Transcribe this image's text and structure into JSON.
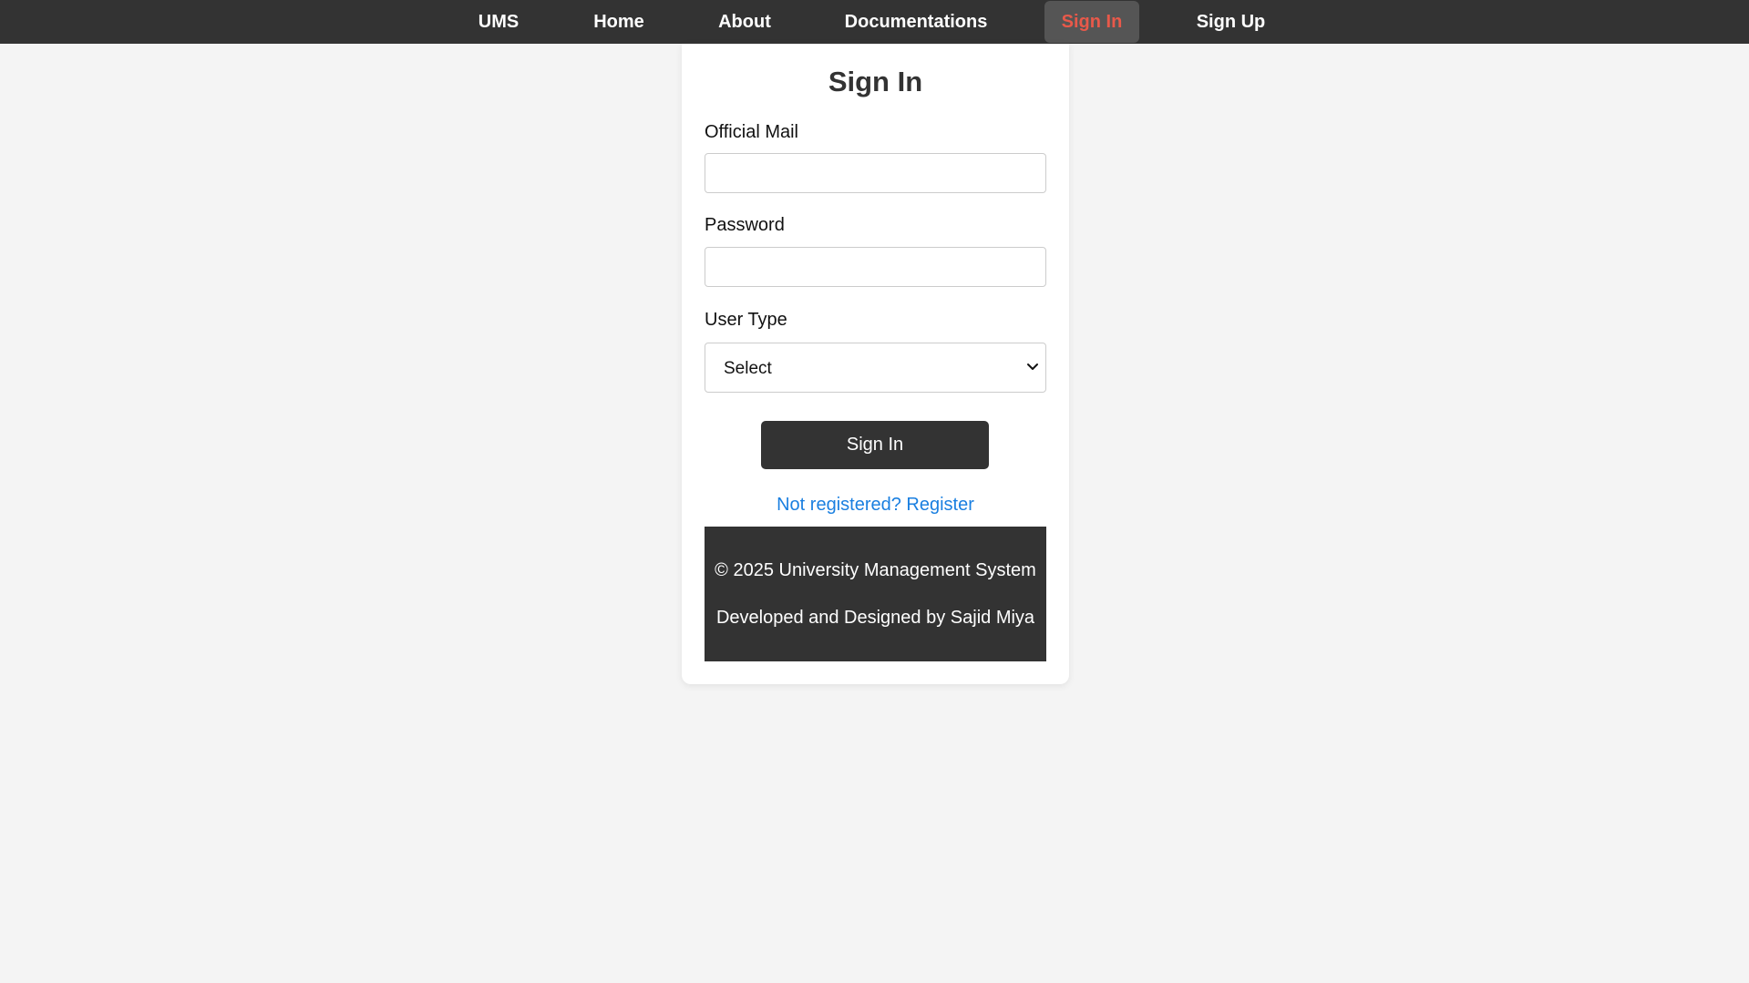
{
  "nav": {
    "brand": "UMS",
    "home": "Home",
    "about": "About",
    "documentations": "Documentations",
    "sign_in": "Sign In",
    "sign_up": "Sign Up",
    "active_color": "#e8594a"
  },
  "form": {
    "title": "Sign In",
    "mail_label": "Official Mail",
    "mail_value": "",
    "password_label": "Password",
    "password_value": "",
    "user_type_label": "User Type",
    "user_type_selected": "Select",
    "submit_label": "Sign In",
    "register_link": "Not registered? Register"
  },
  "footer": {
    "copyright": "© 2025 University Management System",
    "credit": "Developed and Designed by Sajid Miya"
  },
  "icons": {
    "select_arrow": "chevron-down-icon"
  }
}
